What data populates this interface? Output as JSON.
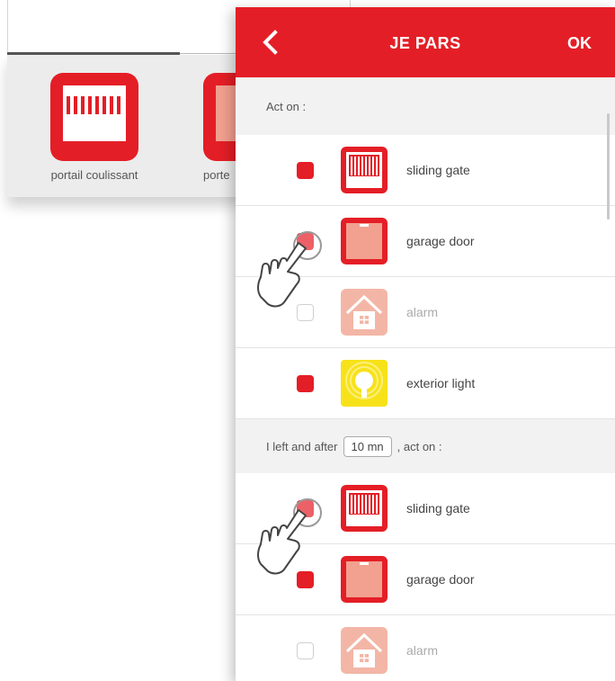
{
  "background": {
    "items": [
      {
        "label": "portail coulissant"
      },
      {
        "label": "porte"
      }
    ]
  },
  "header": {
    "back_icon": "chevron-left-icon",
    "title": "JE PARS",
    "ok_label": "OK",
    "accent": "#e41e26"
  },
  "section1": {
    "label": "Act on :"
  },
  "group1": [
    {
      "label": "sliding gate",
      "checked": true,
      "icon": "sliding-gate-icon"
    },
    {
      "label": "garage door",
      "checked": true,
      "icon": "garage-door-icon"
    },
    {
      "label": "alarm",
      "checked": false,
      "icon": "alarm-house-icon"
    },
    {
      "label": "exterior light",
      "checked": true,
      "icon": "exterior-light-icon"
    }
  ],
  "section2": {
    "prefix": "I left and after",
    "duration": "10 mn",
    "suffix": ", act on :"
  },
  "group2": [
    {
      "label": "sliding gate",
      "checked": true,
      "icon": "sliding-gate-icon"
    },
    {
      "label": "garage door",
      "checked": true,
      "icon": "garage-door-icon"
    },
    {
      "label": "alarm",
      "checked": false,
      "icon": "alarm-house-icon"
    }
  ]
}
